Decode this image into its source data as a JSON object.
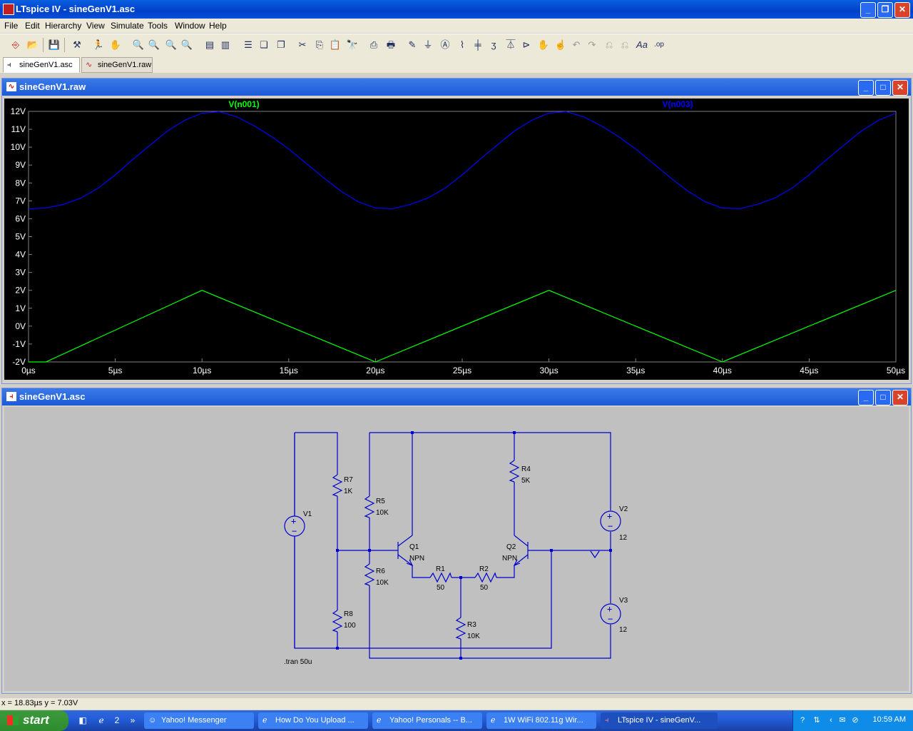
{
  "window": {
    "title": "LTspice IV - sineGenV1.asc"
  },
  "menu": [
    "File",
    "Edit",
    "Hierarchy",
    "View",
    "Simulate",
    "Tools",
    "Window",
    "Help"
  ],
  "tabs": [
    {
      "label": "sineGenV1.asc",
      "icon": "schematic-icon"
    },
    {
      "label": "sineGenV1.raw",
      "icon": "waveform-icon"
    }
  ],
  "waveform_window": {
    "title": "sineGenV1.raw"
  },
  "schematic_window": {
    "title": "sineGenV1.asc"
  },
  "chart_data": {
    "type": "line",
    "x_unit": "µs",
    "xlim": [
      0,
      50
    ],
    "ylim": [
      -2,
      12
    ],
    "x_ticks": [
      "0µs",
      "5µs",
      "10µs",
      "15µs",
      "20µs",
      "25µs",
      "30µs",
      "35µs",
      "40µs",
      "45µs",
      "50µs"
    ],
    "y_ticks": [
      "12V",
      "11V",
      "10V",
      "9V",
      "8V",
      "7V",
      "6V",
      "5V",
      "4V",
      "3V",
      "2V",
      "1V",
      "0V",
      "-1V",
      "-2V"
    ],
    "series": [
      {
        "name": "V(n001)",
        "color": "#00ff00",
        "x": [
          0,
          1,
          10,
          20,
          30,
          40,
          50
        ],
        "y": [
          -2,
          -2,
          2,
          -2,
          2,
          -2,
          2
        ]
      },
      {
        "name": "V(n003)",
        "color": "#0000ff",
        "x": [
          0,
          1,
          2,
          3,
          4,
          5,
          6,
          7,
          8,
          9,
          10,
          11,
          12,
          13,
          14,
          15,
          16,
          17,
          18,
          19,
          20,
          21,
          22,
          23,
          24,
          25,
          26,
          27,
          28,
          29,
          30,
          31,
          32,
          33,
          34,
          35,
          36,
          37,
          38,
          39,
          40,
          41,
          42,
          43,
          44,
          45,
          46,
          47,
          48,
          49,
          50
        ],
        "y": [
          6.55,
          6.6,
          6.8,
          7.15,
          7.7,
          8.45,
          9.3,
          10.1,
          10.9,
          11.5,
          11.9,
          11.98,
          11.7,
          11.2,
          10.6,
          9.9,
          9.1,
          8.3,
          7.55,
          6.95,
          6.6,
          6.56,
          6.8,
          7.15,
          7.7,
          8.45,
          9.3,
          10.1,
          10.9,
          11.5,
          11.9,
          11.98,
          11.7,
          11.2,
          10.6,
          9.9,
          9.1,
          8.3,
          7.55,
          6.95,
          6.6,
          6.56,
          6.8,
          7.15,
          7.7,
          8.45,
          9.3,
          10.1,
          10.9,
          11.5,
          11.9
        ]
      }
    ]
  },
  "schematic": {
    "components": [
      {
        "ref": "V1",
        "value": ""
      },
      {
        "ref": "V2",
        "value": "12"
      },
      {
        "ref": "V3",
        "value": "12"
      },
      {
        "ref": "R7",
        "value": "1K"
      },
      {
        "ref": "R8",
        "value": "100"
      },
      {
        "ref": "R5",
        "value": "10K"
      },
      {
        "ref": "R6",
        "value": "10K"
      },
      {
        "ref": "R4",
        "value": "5K"
      },
      {
        "ref": "R1",
        "value": "50"
      },
      {
        "ref": "R2",
        "value": "50"
      },
      {
        "ref": "R3",
        "value": "10K"
      },
      {
        "ref": "Q1",
        "value": "NPN"
      },
      {
        "ref": "Q2",
        "value": "NPN"
      }
    ],
    "directive": ".tran 50u"
  },
  "status": {
    "cursor": "x = 18.83µs    y = 7.03V"
  },
  "taskbar": {
    "start": "start",
    "tasks": [
      {
        "label": "Yahoo! Messenger",
        "icon": "yahoo-icon"
      },
      {
        "label": "How Do You Upload ...",
        "icon": "ie-icon"
      },
      {
        "label": "Yahoo! Personals -- B...",
        "icon": "ie-icon"
      },
      {
        "label": "1W WiFi 802.11g Wir...",
        "icon": "ie-icon"
      },
      {
        "label": "LTspice IV - sineGenV...",
        "icon": "ltspice-icon"
      }
    ],
    "clock": "10:59 AM"
  }
}
